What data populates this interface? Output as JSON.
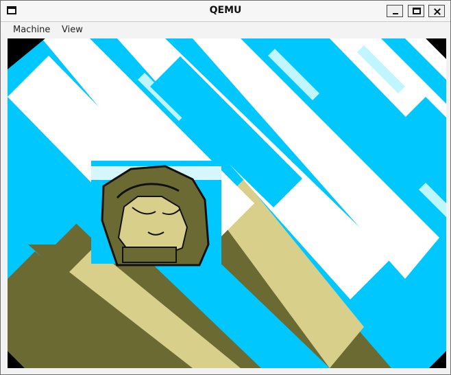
{
  "window": {
    "title": "QEMU",
    "controls": [
      "minimize",
      "maximize",
      "close"
    ]
  },
  "menubar": {
    "items": [
      "Machine",
      "View"
    ]
  },
  "display": {
    "content": "guest screen graphic",
    "colors": {
      "sky": "#00c8ff",
      "white": "#ffffff",
      "olive": "#6b6a33",
      "beige": "#d8cf8a",
      "black": "#000000"
    }
  }
}
